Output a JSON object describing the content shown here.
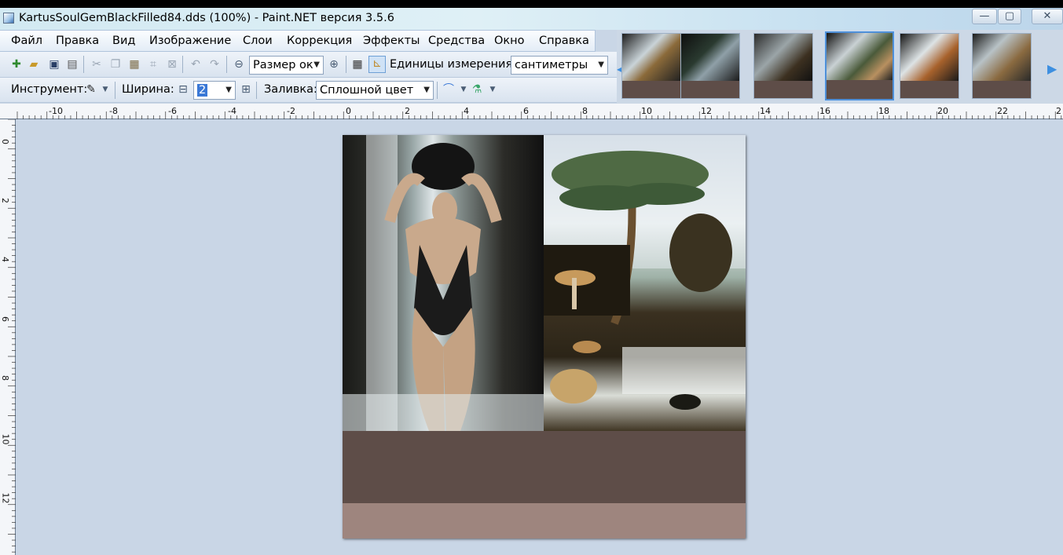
{
  "window": {
    "title": "KartusSoulGemBlackFilled84.dds (100%) - Paint.NET версия 3.5.6",
    "minimize": "—",
    "maximize": "▢",
    "close": "✕"
  },
  "menu": [
    "Файл",
    "Правка",
    "Вид",
    "Изображение",
    "Слои",
    "Коррекция",
    "Эффекты",
    "Средства",
    "Окно",
    "Справка"
  ],
  "toolbar": {
    "zoom_value": "Размер ок",
    "units_label": "Единицы измерения:",
    "units_value": "сантиметры",
    "tool_label": "Инструмент:",
    "width_label": "Ширина:",
    "width_value": "2",
    "fill_label": "Заливка:",
    "fill_value": "Сплошной цвет"
  },
  "ruler": {
    "unit": "см",
    "h_labels": [
      "-10",
      "-8",
      "-6",
      "-4",
      "-2",
      "0",
      "2",
      "4",
      "6",
      "8",
      "10",
      "12",
      "14",
      "16",
      "18",
      "20",
      "22",
      "2"
    ],
    "v_labels": [
      "0",
      "2",
      "4",
      "6",
      "8",
      "10",
      "12"
    ]
  },
  "thumbnails": {
    "count": 6,
    "active_index": 3
  },
  "colors": {
    "band_dark": "#5e4d48",
    "band_light": "#9e857e",
    "workspace": "#c9d6e6",
    "accent": "#4f8fd7"
  }
}
